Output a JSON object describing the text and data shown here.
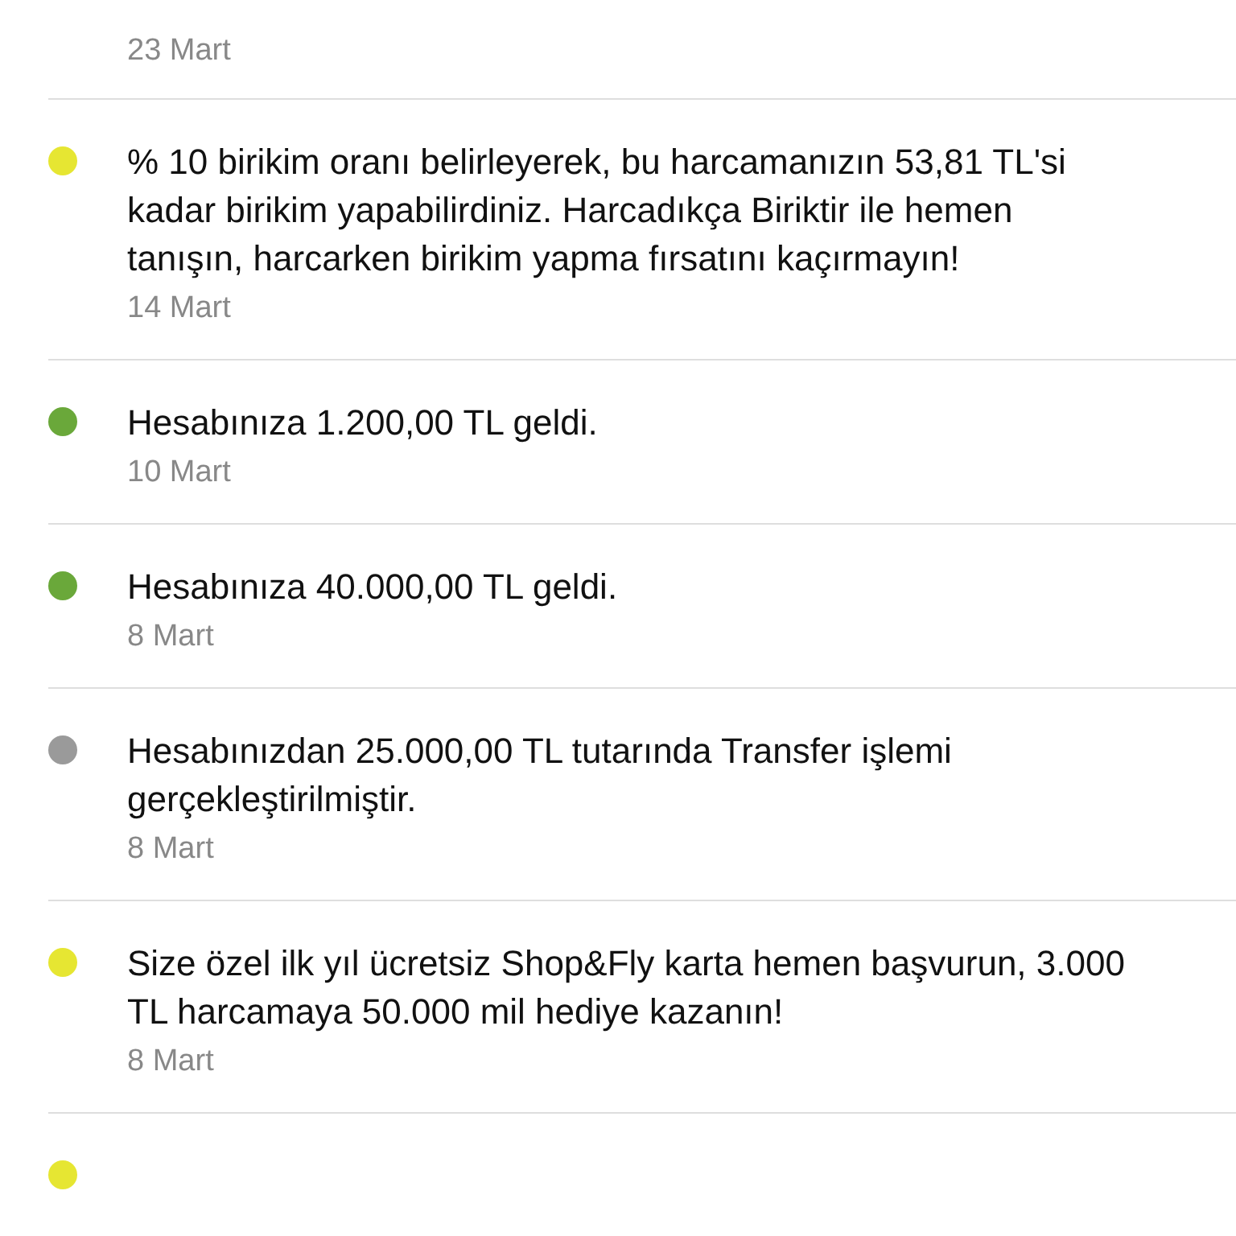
{
  "notifications": [
    {
      "date": "23 Mart"
    },
    {
      "color": "#e6e632",
      "message": "% 10 birikim oranı belirleyerek, bu harcamanızın 53,81 TL'si kadar birikim yapabilirdiniz. Harcadıkça Biriktir ile hemen tanışın, harcarken birikim yapma fırsatını kaçırmayın!",
      "date": "14 Mart"
    },
    {
      "color": "#6aa83a",
      "message": "Hesabınıza 1.200,00 TL geldi.",
      "date": "10 Mart"
    },
    {
      "color": "#6aa83a",
      "message": "Hesabınıza 40.000,00 TL geldi.",
      "date": "8 Mart"
    },
    {
      "color": "#9a9a9a",
      "message": "Hesabınızdan 25.000,00 TL tutarında Transfer işlemi gerçekleştirilmiştir.",
      "date": "8 Mart"
    },
    {
      "color": "#e6e632",
      "message": "Size özel ilk yıl ücretsiz Shop&Fly karta hemen başvurun, 3.000 TL harcamaya 50.000 mil hediye kazanın!",
      "date": "8 Mart"
    },
    {
      "color": "#e6e632"
    }
  ]
}
